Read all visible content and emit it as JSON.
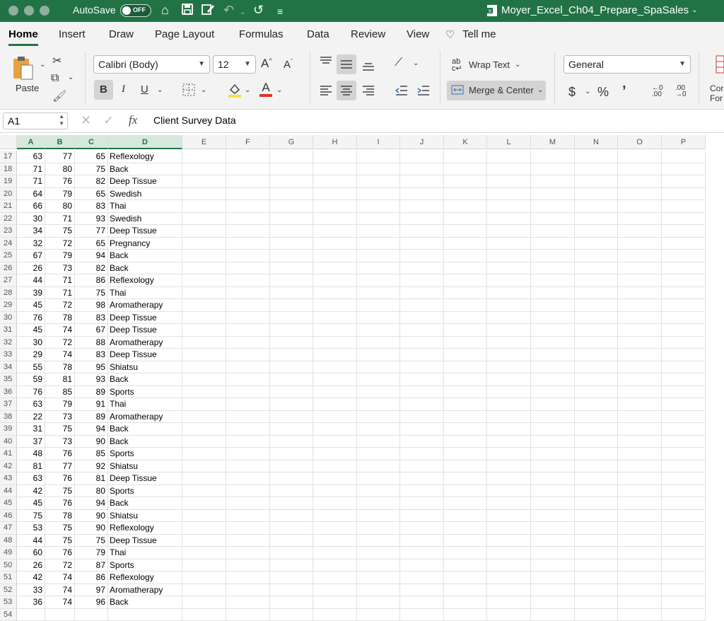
{
  "titlebar": {
    "autosave_label": "AutoSave",
    "autosave_state": "OFF",
    "filename": "Moyer_Excel_Ch04_Prepare_SpaSales"
  },
  "menu": {
    "tabs": [
      "Home",
      "Insert",
      "Draw",
      "Page Layout",
      "Formulas",
      "Data",
      "Review",
      "View",
      "Tell me"
    ],
    "active": "Home"
  },
  "ribbon": {
    "paste_label": "Paste",
    "font_name": "Calibri (Body)",
    "font_size": "12",
    "bold": "B",
    "italic": "I",
    "underline": "U",
    "wrap_text": "Wrap Text",
    "merge_center": "Merge & Center",
    "number_format": "General",
    "currency": "$",
    "percent": "%",
    "comma": "’",
    "increase_decimal": "←.0 .00",
    "decrease_decimal": ".00 →.0",
    "cond_format_line1": "Cor",
    "cond_format_line2": "For"
  },
  "formula_bar": {
    "name_box": "A1",
    "fx": "fx",
    "content": "Client Survey Data"
  },
  "columns": [
    "A",
    "B",
    "C",
    "D",
    "E",
    "F",
    "G",
    "H",
    "I",
    "J",
    "K",
    "L",
    "M",
    "N",
    "O",
    "P"
  ],
  "rows": [
    {
      "n": "17",
      "a": "63",
      "b": "77",
      "c": "65",
      "d": "Reflexology"
    },
    {
      "n": "18",
      "a": "71",
      "b": "80",
      "c": "75",
      "d": "Back"
    },
    {
      "n": "19",
      "a": "71",
      "b": "76",
      "c": "82",
      "d": "Deep Tissue"
    },
    {
      "n": "20",
      "a": "64",
      "b": "79",
      "c": "65",
      "d": "Swedish"
    },
    {
      "n": "21",
      "a": "66",
      "b": "80",
      "c": "83",
      "d": "Thai"
    },
    {
      "n": "22",
      "a": "30",
      "b": "71",
      "c": "93",
      "d": "Swedish"
    },
    {
      "n": "23",
      "a": "34",
      "b": "75",
      "c": "77",
      "d": "Deep Tissue"
    },
    {
      "n": "24",
      "a": "32",
      "b": "72",
      "c": "65",
      "d": "Pregnancy"
    },
    {
      "n": "25",
      "a": "67",
      "b": "79",
      "c": "94",
      "d": "Back"
    },
    {
      "n": "26",
      "a": "26",
      "b": "73",
      "c": "82",
      "d": "Back"
    },
    {
      "n": "27",
      "a": "44",
      "b": "71",
      "c": "86",
      "d": "Reflexology"
    },
    {
      "n": "28",
      "a": "39",
      "b": "71",
      "c": "75",
      "d": "Thai"
    },
    {
      "n": "29",
      "a": "45",
      "b": "72",
      "c": "98",
      "d": "Aromatherapy"
    },
    {
      "n": "30",
      "a": "76",
      "b": "78",
      "c": "83",
      "d": "Deep Tissue"
    },
    {
      "n": "31",
      "a": "45",
      "b": "74",
      "c": "67",
      "d": "Deep Tissue"
    },
    {
      "n": "32",
      "a": "30",
      "b": "72",
      "c": "88",
      "d": "Aromatherapy"
    },
    {
      "n": "33",
      "a": "29",
      "b": "74",
      "c": "83",
      "d": "Deep Tissue"
    },
    {
      "n": "34",
      "a": "55",
      "b": "78",
      "c": "95",
      "d": "Shiatsu"
    },
    {
      "n": "35",
      "a": "59",
      "b": "81",
      "c": "93",
      "d": "Back"
    },
    {
      "n": "36",
      "a": "76",
      "b": "85",
      "c": "89",
      "d": "Sports"
    },
    {
      "n": "37",
      "a": "63",
      "b": "79",
      "c": "91",
      "d": "Thai"
    },
    {
      "n": "38",
      "a": "22",
      "b": "73",
      "c": "89",
      "d": "Aromatherapy"
    },
    {
      "n": "39",
      "a": "31",
      "b": "75",
      "c": "94",
      "d": "Back"
    },
    {
      "n": "40",
      "a": "37",
      "b": "73",
      "c": "90",
      "d": "Back"
    },
    {
      "n": "41",
      "a": "48",
      "b": "76",
      "c": "85",
      "d": "Sports"
    },
    {
      "n": "42",
      "a": "81",
      "b": "77",
      "c": "92",
      "d": "Shiatsu"
    },
    {
      "n": "43",
      "a": "63",
      "b": "76",
      "c": "81",
      "d": "Deep Tissue"
    },
    {
      "n": "44",
      "a": "42",
      "b": "75",
      "c": "80",
      "d": "Sports"
    },
    {
      "n": "45",
      "a": "45",
      "b": "76",
      "c": "94",
      "d": "Back"
    },
    {
      "n": "46",
      "a": "75",
      "b": "78",
      "c": "90",
      "d": "Shiatsu"
    },
    {
      "n": "47",
      "a": "53",
      "b": "75",
      "c": "90",
      "d": "Reflexology"
    },
    {
      "n": "48",
      "a": "44",
      "b": "75",
      "c": "75",
      "d": "Deep Tissue"
    },
    {
      "n": "49",
      "a": "60",
      "b": "76",
      "c": "79",
      "d": "Thai"
    },
    {
      "n": "50",
      "a": "26",
      "b": "72",
      "c": "87",
      "d": "Sports"
    },
    {
      "n": "51",
      "a": "42",
      "b": "74",
      "c": "86",
      "d": "Reflexology"
    },
    {
      "n": "52",
      "a": "33",
      "b": "74",
      "c": "97",
      "d": "Aromatherapy"
    },
    {
      "n": "53",
      "a": "36",
      "b": "74",
      "c": "96",
      "d": "Back"
    },
    {
      "n": "54",
      "a": "",
      "b": "",
      "c": "",
      "d": ""
    }
  ],
  "colors": {
    "excel_green": "#217346",
    "ribbon_bg": "#f3f3f3"
  }
}
